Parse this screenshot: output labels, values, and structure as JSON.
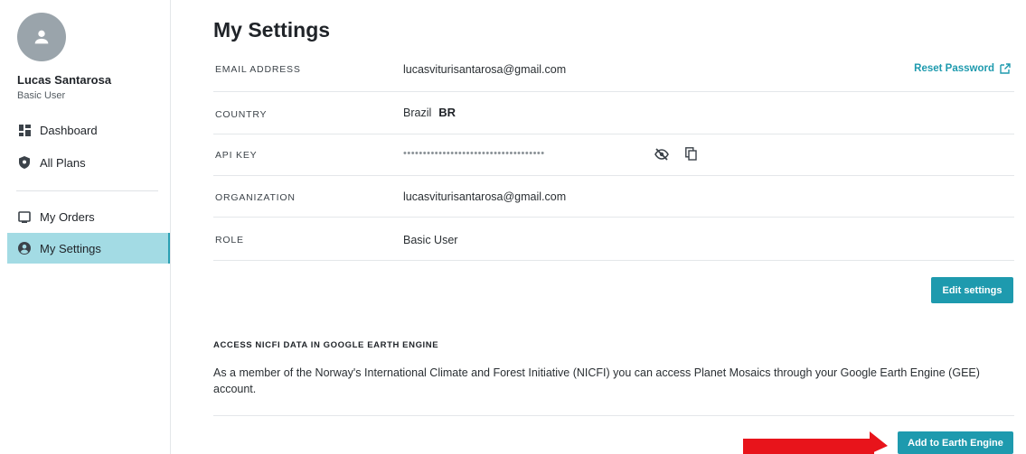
{
  "user": {
    "name": "Lucas Santarosa",
    "role": "Basic User",
    "avatar_icon": "person-icon"
  },
  "sidebar": {
    "items": [
      {
        "label": "Dashboard",
        "icon": "dashboard-icon"
      },
      {
        "label": "All Plans",
        "icon": "shield-icon"
      },
      {
        "label": "My Orders",
        "icon": "orders-icon"
      },
      {
        "label": "My Settings",
        "icon": "account-circle-icon",
        "active": true
      }
    ]
  },
  "main": {
    "title": "My Settings",
    "fields": {
      "email": {
        "label": "EMAIL ADDRESS",
        "value": "lucasviturisantarosa@gmail.com"
      },
      "country": {
        "label": "COUNTRY",
        "value": "Brazil",
        "code": "BR"
      },
      "api_key": {
        "label": "API KEY",
        "value": "••••••••••••••••••••••••••••••••••••"
      },
      "organization": {
        "label": "ORGANIZATION",
        "value": "lucasviturisantarosa@gmail.com"
      },
      "role": {
        "label": "ROLE",
        "value": "Basic User"
      }
    },
    "reset_password_label": "Reset Password",
    "edit_settings_label": "Edit settings",
    "nicfi": {
      "title": "ACCESS NICFI DATA IN GOOGLE EARTH ENGINE",
      "description": "As a member of the Norway's International Climate and Forest Initiative (NICFI) you can access Planet Mosaics through your Google Earth Engine (GEE) account.",
      "button_label": "Add to Earth Engine"
    }
  },
  "colors": {
    "accent": "#1e9aae",
    "active_nav": "#a3dbe4",
    "annotation_arrow": "#e8141b"
  }
}
